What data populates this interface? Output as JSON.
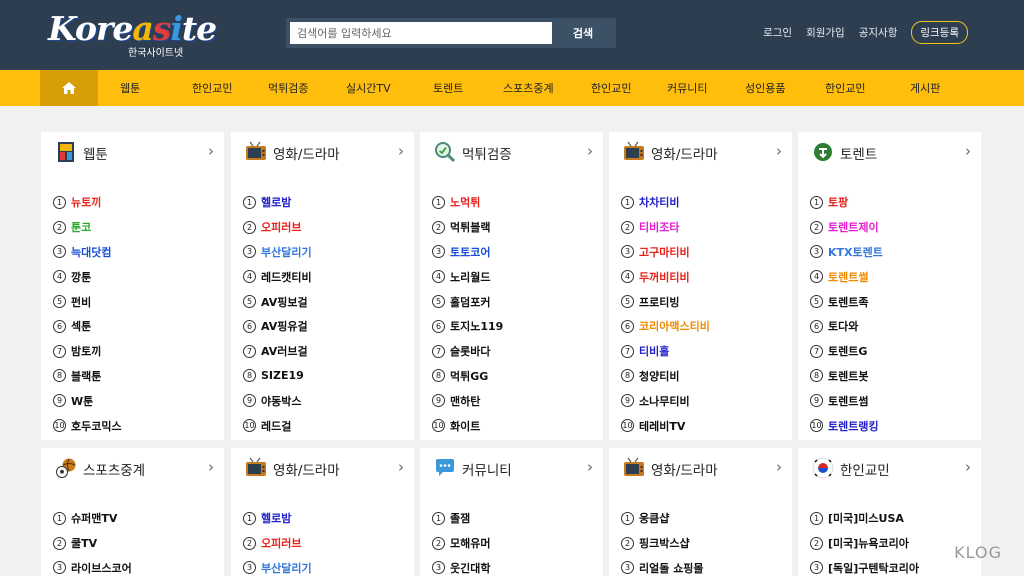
{
  "header": {
    "logo_text": "Koreasite",
    "logo_sub": "한국사이트넷",
    "search_placeholder": "검색어를 입력하세요",
    "search_button": "검색",
    "links": [
      "로그인",
      "회원가입",
      "공지사항"
    ],
    "link_register": "링크등록"
  },
  "nav": {
    "items": [
      "웹툰",
      "한인교민",
      "먹튀검증",
      "실시간TV",
      "토렌트",
      "스포츠중계",
      "한인교민",
      "커뮤니티",
      "성인용품",
      "한인교민",
      "게시판"
    ]
  },
  "colors": {
    "header_bg": "#2d3e50",
    "nav_bg": "#ffbe0b",
    "nav_home_bg": "#d79e08",
    "red": "#e8231d",
    "green": "#2aa82a",
    "blue": "#1a4fd6",
    "navy": "#2222c8",
    "pink": "#e21fd0",
    "cornflower": "#3377dd",
    "orange": "#f08a00",
    "black": "#111111"
  },
  "cards": [
    {
      "title": "웹툰",
      "icon": "webtoon-icon",
      "items": [
        {
          "n": "1",
          "name": "뉴토끼",
          "color": "#e8231d"
        },
        {
          "n": "2",
          "name": "툰코",
          "color": "#2aa82a"
        },
        {
          "n": "3",
          "name": "늑대닷컴",
          "color": "#1a4fd6"
        },
        {
          "n": "4",
          "name": "깡툰",
          "color": "#111111"
        },
        {
          "n": "5",
          "name": "펀비",
          "color": "#111111"
        },
        {
          "n": "6",
          "name": "섹툰",
          "color": "#111111"
        },
        {
          "n": "7",
          "name": "밤토끼",
          "color": "#111111"
        },
        {
          "n": "8",
          "name": "블랙툰",
          "color": "#111111"
        },
        {
          "n": "9",
          "name": "W툰",
          "color": "#111111"
        },
        {
          "n": "10",
          "name": "호두코믹스",
          "color": "#111111"
        }
      ]
    },
    {
      "title": "영화/드라마",
      "icon": "tv-icon",
      "items": [
        {
          "n": "1",
          "name": "헬로밤",
          "color": "#2222c8"
        },
        {
          "n": "2",
          "name": "오피러브",
          "color": "#e8231d"
        },
        {
          "n": "3",
          "name": "부산달리기",
          "color": "#3377dd"
        },
        {
          "n": "4",
          "name": "레드캣티비",
          "color": "#111111"
        },
        {
          "n": "5",
          "name": "AV핑보걸",
          "color": "#111111"
        },
        {
          "n": "6",
          "name": "AV핑유걸",
          "color": "#111111"
        },
        {
          "n": "7",
          "name": "AV러브걸",
          "color": "#111111"
        },
        {
          "n": "8",
          "name": "SIZE19",
          "color": "#111111"
        },
        {
          "n": "9",
          "name": "야동박스",
          "color": "#111111"
        },
        {
          "n": "10",
          "name": "레드걸",
          "color": "#111111"
        }
      ]
    },
    {
      "title": "먹튀검증",
      "icon": "magnifier-icon",
      "items": [
        {
          "n": "1",
          "name": "노먹튀",
          "color": "#e8231d"
        },
        {
          "n": "2",
          "name": "먹튀블랙",
          "color": "#111111"
        },
        {
          "n": "3",
          "name": "토토코어",
          "color": "#1a4fd6"
        },
        {
          "n": "4",
          "name": "노리월드",
          "color": "#111111"
        },
        {
          "n": "5",
          "name": "홀덤포커",
          "color": "#111111"
        },
        {
          "n": "6",
          "name": "토지노119",
          "color": "#111111"
        },
        {
          "n": "7",
          "name": "슬롯바다",
          "color": "#111111"
        },
        {
          "n": "8",
          "name": "먹튀GG",
          "color": "#111111"
        },
        {
          "n": "9",
          "name": "맨하탄",
          "color": "#111111"
        },
        {
          "n": "10",
          "name": "화이트",
          "color": "#111111"
        }
      ]
    },
    {
      "title": "영화/드라마",
      "icon": "tv-icon",
      "items": [
        {
          "n": "1",
          "name": "차차티비",
          "color": "#2222c8"
        },
        {
          "n": "2",
          "name": "티비조타",
          "color": "#e21fd0"
        },
        {
          "n": "3",
          "name": "고구마티비",
          "color": "#e8231d"
        },
        {
          "n": "4",
          "name": "두꺼비티비",
          "color": "#e8231d"
        },
        {
          "n": "5",
          "name": "프로티빙",
          "color": "#111111"
        },
        {
          "n": "6",
          "name": "코리아맥스티비",
          "color": "#f08a00"
        },
        {
          "n": "7",
          "name": "티비홀",
          "color": "#2222c8"
        },
        {
          "n": "8",
          "name": "청양티비",
          "color": "#111111"
        },
        {
          "n": "9",
          "name": "소나무티비",
          "color": "#111111"
        },
        {
          "n": "10",
          "name": "테레비TV",
          "color": "#111111"
        }
      ]
    },
    {
      "title": "토렌트",
      "icon": "torrent-icon",
      "items": [
        {
          "n": "1",
          "name": "토팡",
          "color": "#e8231d"
        },
        {
          "n": "2",
          "name": "토렌트제이",
          "color": "#e21fd0"
        },
        {
          "n": "3",
          "name": "KTX토렌트",
          "color": "#3377dd"
        },
        {
          "n": "4",
          "name": "토렌트썰",
          "color": "#f08a00"
        },
        {
          "n": "5",
          "name": "토렌트족",
          "color": "#111111"
        },
        {
          "n": "6",
          "name": "토다와",
          "color": "#111111"
        },
        {
          "n": "7",
          "name": "토렌트G",
          "color": "#111111"
        },
        {
          "n": "8",
          "name": "토렌트봇",
          "color": "#111111"
        },
        {
          "n": "9",
          "name": "토렌트썸",
          "color": "#111111"
        },
        {
          "n": "10",
          "name": "토렌트랭킹",
          "color": "#2222c8"
        }
      ]
    },
    {
      "title": "스포츠중계",
      "icon": "sports-ball-icon",
      "items": [
        {
          "n": "1",
          "name": "슈퍼맨TV",
          "color": "#111111"
        },
        {
          "n": "2",
          "name": "쿨TV",
          "color": "#111111"
        },
        {
          "n": "3",
          "name": "라이브스코어",
          "color": "#111111"
        }
      ]
    },
    {
      "title": "영화/드라마",
      "icon": "tv-icon",
      "items": [
        {
          "n": "1",
          "name": "헬로밤",
          "color": "#2222c8"
        },
        {
          "n": "2",
          "name": "오피러브",
          "color": "#e8231d"
        },
        {
          "n": "3",
          "name": "부산달리기",
          "color": "#3377dd"
        }
      ]
    },
    {
      "title": "커뮤니티",
      "icon": "chat-bubble-icon",
      "items": [
        {
          "n": "1",
          "name": "졸잼",
          "color": "#111111"
        },
        {
          "n": "2",
          "name": "모해유머",
          "color": "#111111"
        },
        {
          "n": "3",
          "name": "웃긴대학",
          "color": "#111111"
        }
      ]
    },
    {
      "title": "영화/드라마",
      "icon": "tv-icon",
      "items": [
        {
          "n": "1",
          "name": "웅큼샵",
          "color": "#111111"
        },
        {
          "n": "2",
          "name": "핑크박스샵",
          "color": "#111111"
        },
        {
          "n": "3",
          "name": "리얼돌 쇼핑몰",
          "color": "#111111"
        }
      ]
    },
    {
      "title": "한인교민",
      "icon": "korea-flag-icon",
      "items": [
        {
          "n": "1",
          "name": "[미국]미스USA",
          "color": "#111111"
        },
        {
          "n": "2",
          "name": "[미국]뉴욕코리아",
          "color": "#111111"
        },
        {
          "n": "3",
          "name": "[독일]구텐탁코리아",
          "color": "#111111"
        }
      ]
    }
  ],
  "watermark": "KLOG"
}
